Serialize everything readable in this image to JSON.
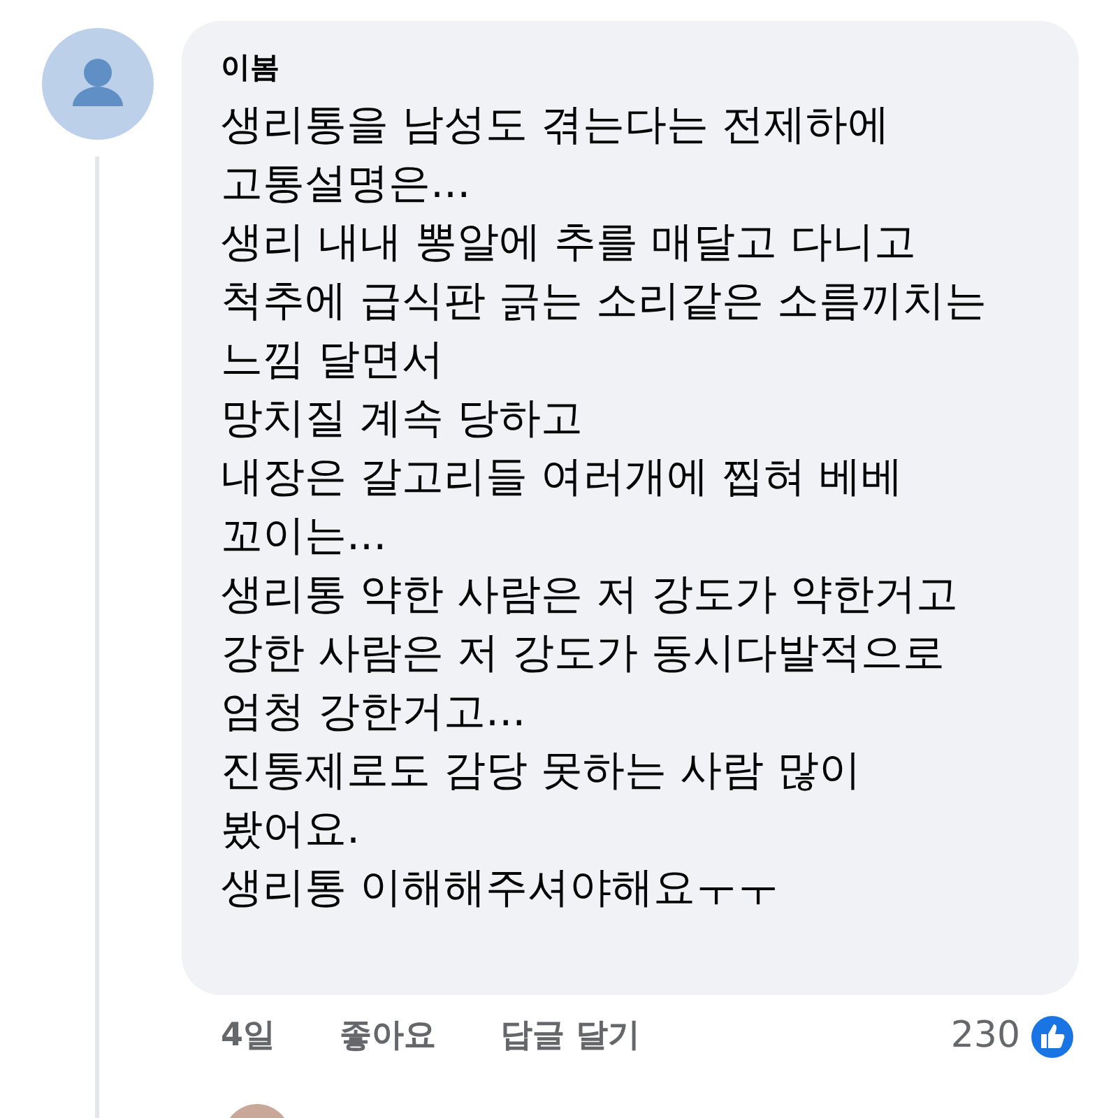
{
  "comment": {
    "author": "이봄",
    "lines": [
      "생리통을 남성도 겪는다는 전제하에",
      "고통설명은...",
      "생리 내내 뽕알에 추를 매달고 다니고",
      "척추에 급식판 긁는 소리같은 소름끼치는",
      "느낌 달면서",
      "망치질 계속 당하고",
      "내장은 갈고리들 여러개에 찝혀 베베",
      "꼬이는...",
      "생리통 약한 사람은 저 강도가 약한거고",
      "강한 사람은 저 강도가 동시다발적으로",
      "엄청 강한거고...",
      "진통제로도 감당 못하는 사람 많이",
      "봤어요.",
      "생리통 이해해주셔야해요ㅜㅜ"
    ],
    "time": "4일",
    "actions": [
      "좋아요",
      "답글 달기"
    ],
    "reaction_count": "230"
  }
}
